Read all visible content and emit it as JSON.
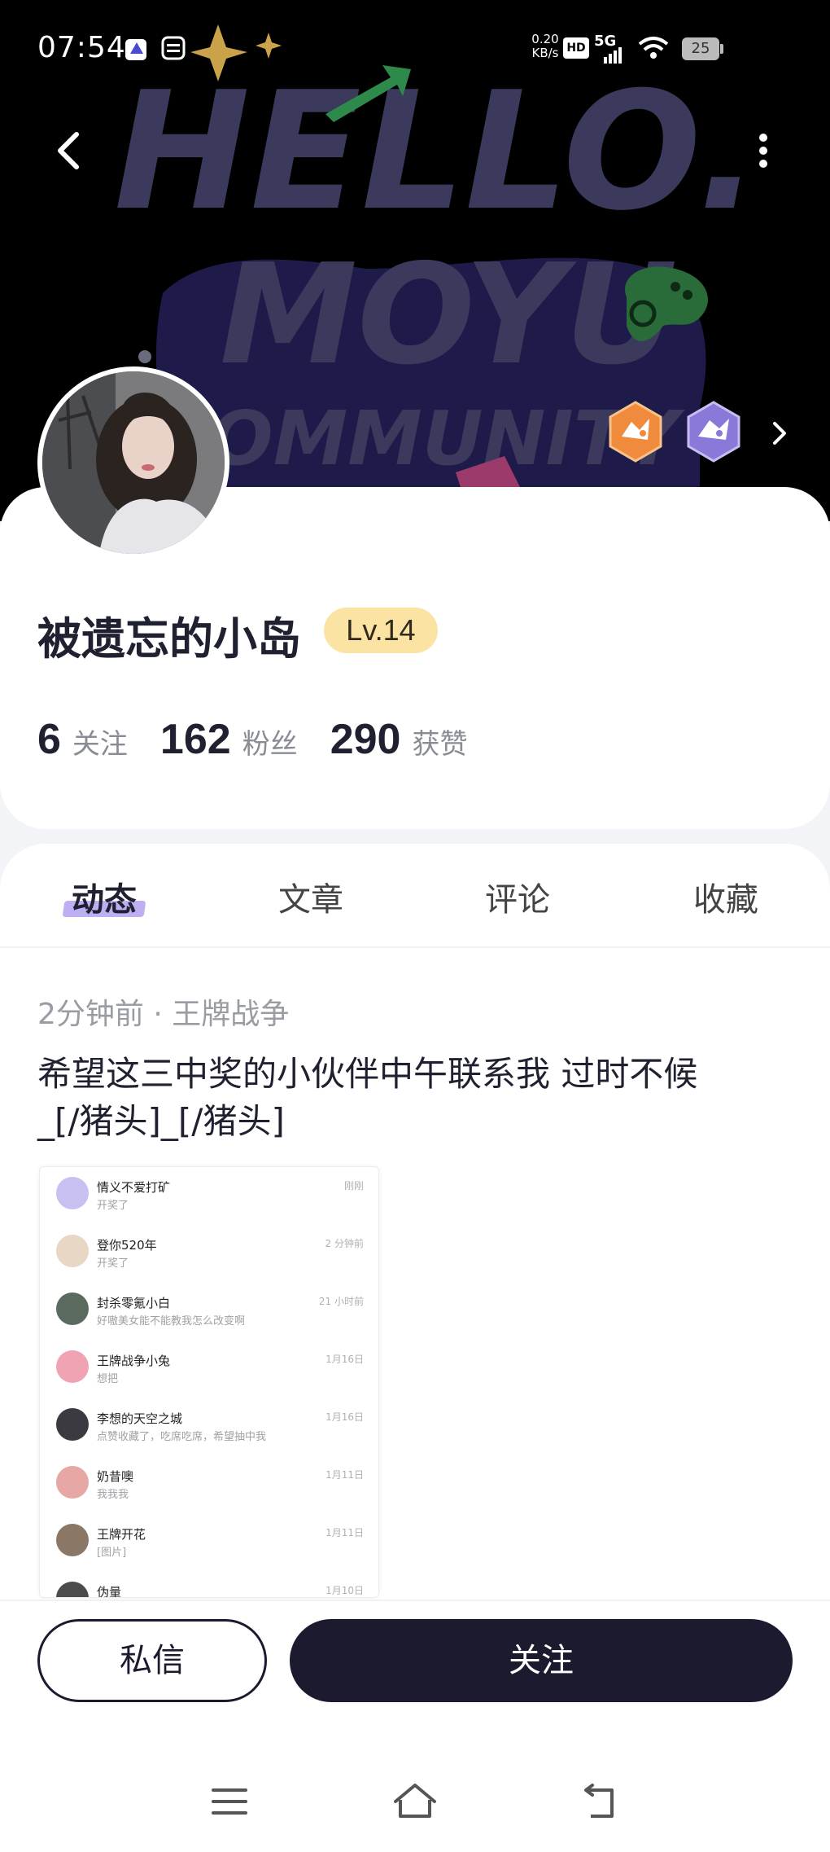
{
  "status_bar": {
    "time": "07:54",
    "net_speed_value": "0.20",
    "net_speed_unit": "KB/s",
    "hd": "HD",
    "network": "5G",
    "battery": "25"
  },
  "banner": {
    "art_text_line1": "HELLO.",
    "art_text_line2": "MOYU",
    "art_text_line3": "COMMUNITY",
    "back_icon": "chevron-left-icon",
    "more_icon": "more-vertical-icon",
    "badges": [
      "orange-medal-icon",
      "purple-medal-icon"
    ]
  },
  "profile": {
    "username": "被遗忘的小岛",
    "level": "Lv.14",
    "stats": [
      {
        "value": "6",
        "label": "关注"
      },
      {
        "value": "162",
        "label": "粉丝"
      },
      {
        "value": "290",
        "label": "获赞"
      }
    ]
  },
  "tabs": [
    "动态",
    "文章",
    "评论",
    "收藏"
  ],
  "active_tab": "动态",
  "post": {
    "meta": "2分钟前 · 王牌战争",
    "text_line1": "希望这三中奖的小伙伴中午联系我 过时不候",
    "text_line2": "_[/猪头]_[/猪头]",
    "image_rows": [
      {
        "name": "情义不爱打矿",
        "msg": "开奖了",
        "time": "刚刚",
        "color": "#c9c0f2"
      },
      {
        "name": "登你520年",
        "msg": "开奖了",
        "time": "2 分钟前",
        "color": "#e8d7c2"
      },
      {
        "name": "封杀零氪小白",
        "msg": "好嗷美女能不能教我怎么改变啊",
        "time": "21 小时前",
        "color": "#5b6a5e"
      },
      {
        "name": "王牌战争小兔",
        "msg": "想把",
        "time": "1月16日",
        "color": "#f0a3b3"
      },
      {
        "name": "李想的天空之城",
        "msg": "点赞收藏了，吃席吃席，希望抽中我",
        "time": "1月16日",
        "color": "#3a3a40"
      },
      {
        "name": "奶昔噢",
        "msg": "我我我",
        "time": "1月11日",
        "color": "#e6a7a5"
      },
      {
        "name": "王牌开花",
        "msg": "[图片]",
        "time": "1月11日",
        "color": "#8a7766"
      },
      {
        "name": "伪量",
        "msg": "",
        "time": "1月10日",
        "color": "#4b4b4b"
      }
    ]
  },
  "actions": {
    "dm": "私信",
    "follow": "关注"
  },
  "colors": {
    "primary_dark": "#1b1a2e",
    "level_badge": "#fbe3a3",
    "tab_highlight": "#b7a6f2",
    "banner_text": "#3c3a5c"
  }
}
